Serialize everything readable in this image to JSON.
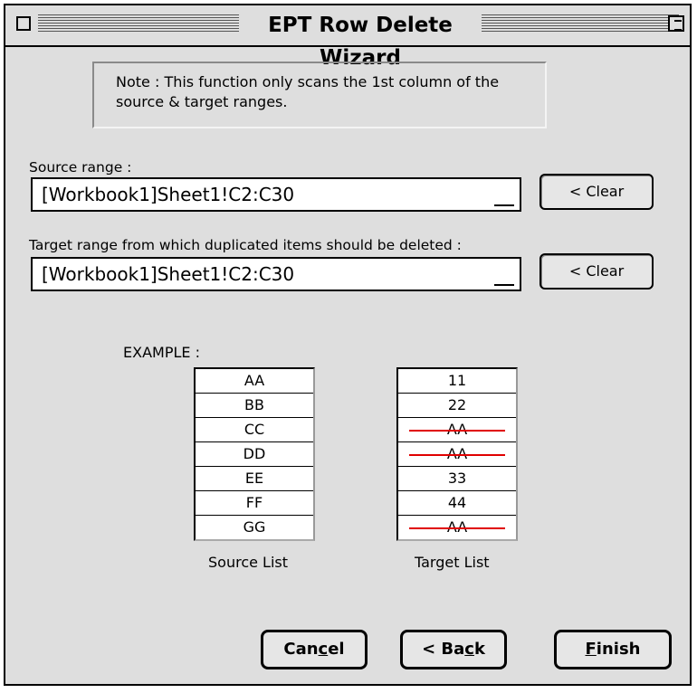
{
  "window": {
    "title": "EPT Row Delete Wizard"
  },
  "note": "Note : This function only scans the 1st column of the source & target ranges.",
  "source": {
    "label": "Source range :",
    "value": "[Workbook1]Sheet1!C2:C30",
    "clear_label": "< Clear"
  },
  "target": {
    "label": "Target range from which duplicated items should be deleted :",
    "value": "[Workbook1]Sheet1!C2:C30",
    "clear_label": "< Clear"
  },
  "example": {
    "label": "EXAMPLE :",
    "source_list": {
      "caption": "Source List",
      "items": [
        "AA",
        "BB",
        "CC",
        "DD",
        "EE",
        "FF",
        "GG"
      ]
    },
    "target_list": {
      "caption": "Target List",
      "items": [
        {
          "text": "11",
          "struck": false
        },
        {
          "text": "22",
          "struck": false
        },
        {
          "text": "AA",
          "struck": true
        },
        {
          "text": "AA",
          "struck": true
        },
        {
          "text": "33",
          "struck": false
        },
        {
          "text": "44",
          "struck": false
        },
        {
          "text": "AA",
          "struck": true
        }
      ]
    }
  },
  "buttons": {
    "cancel": {
      "pre": "Can",
      "mn": "c",
      "post": "el"
    },
    "back": {
      "pre": "< Ba",
      "mn": "c",
      "post": "k"
    },
    "finish": {
      "pre": "",
      "mn": "F",
      "post": "inish"
    }
  },
  "colors": {
    "background": "#dedede",
    "strike": "#e00000"
  }
}
